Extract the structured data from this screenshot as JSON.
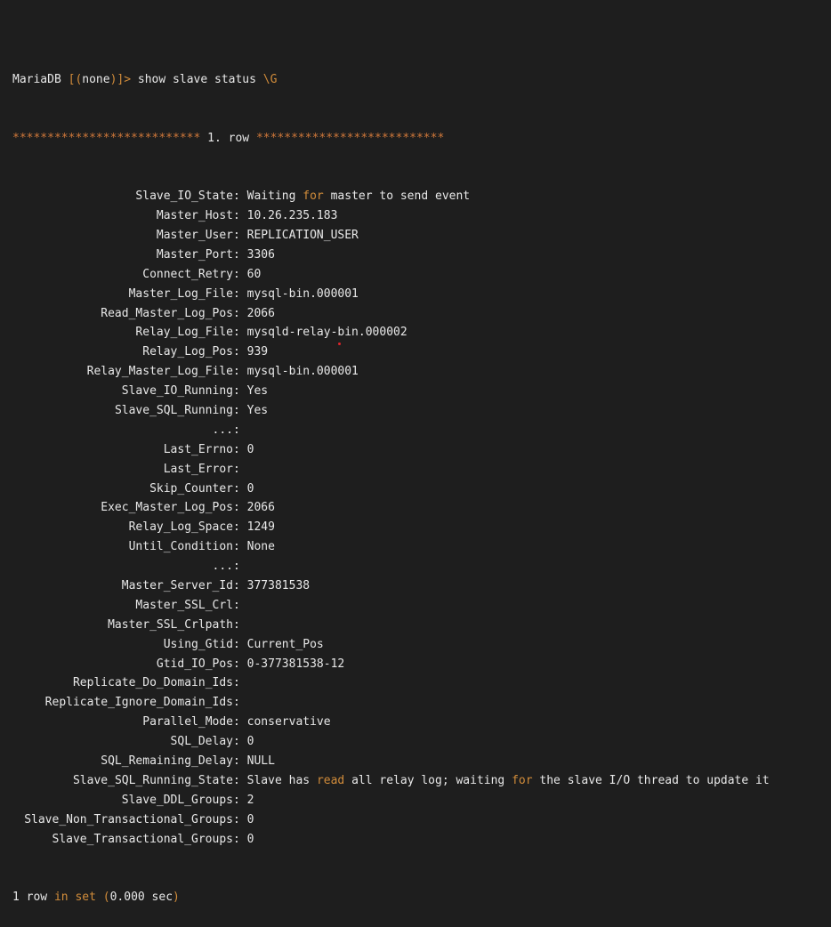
{
  "prompt": {
    "client": "MariaDB",
    "db_open": "[",
    "db_paren_open": "(",
    "db_name": "none",
    "db_paren_close": ")",
    "db_close": "]>",
    "command": "show slave status",
    "terminator": "\\G"
  },
  "row_header": {
    "stars_left": "***************************",
    "label": "1. row",
    "stars_right": "***************************"
  },
  "rows": [
    {
      "key": "Slave_IO_State",
      "value": ""
    },
    {
      "key": "Master_Host",
      "value": "10.26.235.183"
    },
    {
      "key": "Master_User",
      "value": "REPLICATION_USER"
    },
    {
      "key": "Master_Port",
      "value": "3306"
    },
    {
      "key": "Connect_Retry",
      "value": "60"
    },
    {
      "key": "Master_Log_File",
      "value": "mysql-bin.000001"
    },
    {
      "key": "Read_Master_Log_Pos",
      "value": "2066"
    },
    {
      "key": "Relay_Log_File",
      "value": "mysqld-relay-bin.000002"
    },
    {
      "key": "Relay_Log_Pos",
      "value": "939"
    },
    {
      "key": "Relay_Master_Log_File",
      "value": "mysql-bin.000001"
    },
    {
      "key": "Slave_IO_Running",
      "value": "Yes"
    },
    {
      "key": "Slave_SQL_Running",
      "value": "Yes"
    },
    {
      "key": "...",
      "value": ""
    },
    {
      "key": "Last_Errno",
      "value": "0"
    },
    {
      "key": "Last_Error",
      "value": ""
    },
    {
      "key": "Skip_Counter",
      "value": "0"
    },
    {
      "key": "Exec_Master_Log_Pos",
      "value": "2066"
    },
    {
      "key": "Relay_Log_Space",
      "value": "1249"
    },
    {
      "key": "Until_Condition",
      "value": "None"
    },
    {
      "key": "...",
      "value": ""
    },
    {
      "key": "Master_Server_Id",
      "value": "377381538"
    },
    {
      "key": "Master_SSL_Crl",
      "value": ""
    },
    {
      "key": "Master_SSL_Crlpath",
      "value": ""
    },
    {
      "key": "Using_Gtid",
      "value": "Current_Pos"
    },
    {
      "key": "Gtid_IO_Pos",
      "value": "0-377381538-12"
    },
    {
      "key": "Replicate_Do_Domain_Ids",
      "value": ""
    },
    {
      "key": "Replicate_Ignore_Domain_Ids",
      "value": ""
    },
    {
      "key": "Parallel_Mode",
      "value": "conservative"
    },
    {
      "key": "SQL_Delay",
      "value": "0"
    },
    {
      "key": "SQL_Remaining_Delay",
      "value": "NULL"
    },
    {
      "key": "Slave_SQL_Running_State",
      "value": ""
    },
    {
      "key": "Slave_DDL_Groups",
      "value": "2"
    },
    {
      "key": "Slave_Non_Transactional_Groups",
      "value": "0"
    },
    {
      "key": "Slave_Transactional_Groups",
      "value": "0"
    }
  ],
  "io_state": {
    "part1": "Waiting ",
    "kw_for": "for",
    "part2": " master to send event"
  },
  "sql_state": {
    "part1": "Slave has ",
    "kw_read": "read",
    "part2": " all relay log; waiting ",
    "kw_for": "for",
    "part3": " the slave I/O thread to update it"
  },
  "footer": {
    "count": "1 row ",
    "kw_in": "in",
    "space": " ",
    "kw_set": "set",
    "paren_open": " (",
    "time": "0.000 sec",
    "paren_close": ")"
  },
  "colors": {
    "background": "#1e1e1e",
    "text": "#e8e8e8",
    "keyword": "#d18c3a",
    "stars": "#d0783a",
    "cursor_dot": "#e0242a"
  }
}
